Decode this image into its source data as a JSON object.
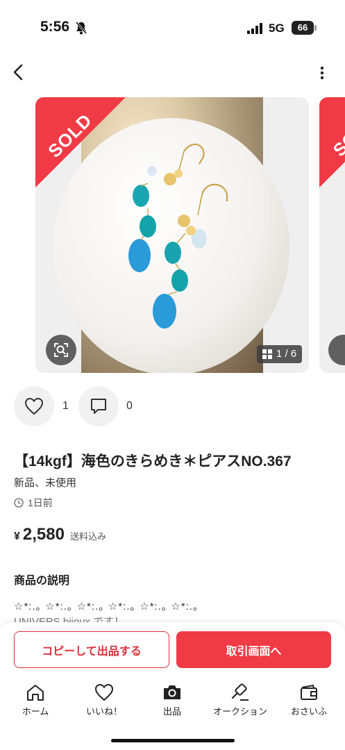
{
  "status_bar": {
    "time": "5:56",
    "network": "5G",
    "battery": "66"
  },
  "carousel": {
    "sold_label": "SOLD",
    "counter": "1 / 6"
  },
  "social": {
    "like_count": "1",
    "comment_count": "0"
  },
  "item": {
    "title": "【14kgf】海色のきらめき＊ピアスNO.367",
    "condition": "新品、未使用",
    "posted": "1日前",
    "currency": "¥",
    "price": "2,580",
    "shipping": "送料込み"
  },
  "description": {
    "heading": "商品の説明",
    "line1": "☆*:.｡ ☆*:.｡ ☆*:.｡ ☆*:.｡ ☆*:.｡ ☆*:.｡",
    "line2": "UNIVERS bijoux です！"
  },
  "actions": {
    "copy_label": "コピーして出品する",
    "trade_label": "取引画面へ"
  },
  "tabbar": {
    "home": "ホーム",
    "likes": "いいね！",
    "sell": "出品",
    "auction": "オークション",
    "wallet": "おさいふ"
  },
  "colors": {
    "accent": "#f03b46",
    "accent_dark": "#e0303b"
  },
  "icons": [
    "bell-off-icon",
    "signal-icon",
    "back-arrow-icon",
    "more-vertical-icon",
    "scan-icon",
    "grid-icon",
    "heart-icon",
    "comment-icon",
    "clock-icon",
    "home-icon",
    "camera-icon",
    "gavel-icon",
    "wallet-icon"
  ]
}
